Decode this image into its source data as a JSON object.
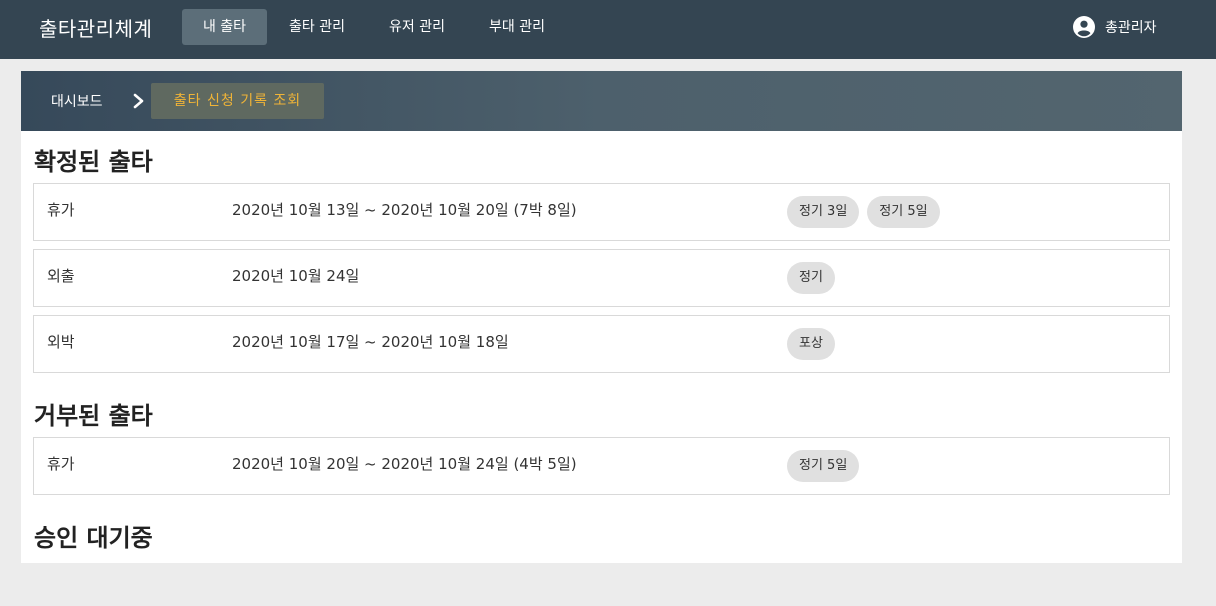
{
  "nav": {
    "brand": "출타관리체계",
    "items": [
      {
        "label": "내 출타",
        "active": true
      },
      {
        "label": "출타 관리",
        "active": false
      },
      {
        "label": "유저 관리",
        "active": false
      },
      {
        "label": "부대 관리",
        "active": false
      }
    ],
    "user": {
      "label": "총관리자",
      "icon": "account-circle-icon"
    }
  },
  "breadcrumb": {
    "home": "대시보드",
    "separator_icon": "chevron-right-icon",
    "current": "출타 신청 기록 조회"
  },
  "sections": {
    "confirmed": {
      "title": "확정된 출타",
      "rows": [
        {
          "type": "휴가",
          "dates": "2020년 10월 13일 ~ 2020년 10월 20일 (7박 8일)",
          "chips": [
            "정기 3일",
            "정기 5일"
          ]
        },
        {
          "type": "외출",
          "dates": "2020년 10월 24일",
          "chips": [
            "정기"
          ]
        },
        {
          "type": "외박",
          "dates": "2020년 10월 17일 ~ 2020년 10월 18일",
          "chips": [
            "포상"
          ]
        }
      ]
    },
    "rejected": {
      "title": "거부된 출타",
      "rows": [
        {
          "type": "휴가",
          "dates": "2020년 10월 20일 ~ 2020년 10월 24일 (4박 5일)",
          "chips": [
            "정기 5일"
          ]
        }
      ]
    },
    "pending": {
      "title": "승인 대기중",
      "rows": []
    }
  },
  "colors": {
    "topbar": "#344552",
    "nav_active": "#5c6e79",
    "breadcrumb_current_text": "#f0b437",
    "chip_bg": "#e0e0e0",
    "page_bg": "#ececec"
  }
}
